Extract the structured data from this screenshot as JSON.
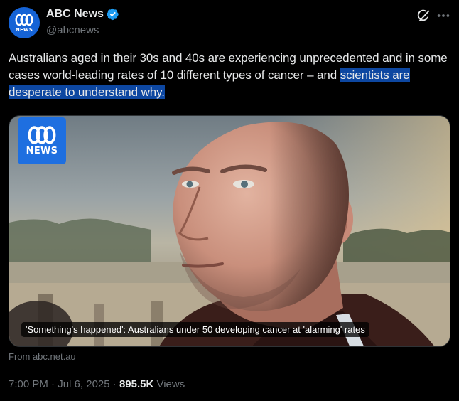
{
  "account": {
    "display_name": "ABC News",
    "handle": "@abcnews",
    "avatar_text": "NEWS"
  },
  "tweet": {
    "text_plain": "Australians aged in their 30s and 40s are experiencing unprecedented and in some cases world-leading rates of 10 different types of cancer – and ",
    "text_highlighted": "scientists are desperate to understand why."
  },
  "card": {
    "logo_text": "NEWS",
    "caption": "'Something's happened': Australians under 50 developing cancer at 'alarming' rates",
    "source": "From abc.net.au"
  },
  "meta": {
    "time": "7:00 PM",
    "separator1": " · ",
    "date": "Jul 6, 2025",
    "separator2": " · ",
    "views_count": "895.5K",
    "views_label": " Views"
  },
  "colors": {
    "background": "#000000",
    "text": "#e7e9ea",
    "secondary_text": "#71767b",
    "verified": "#1d9bf0",
    "highlight": "#0d47a1",
    "abc_blue": "#1e6fe0"
  },
  "icons": [
    "abc-news-logo-icon",
    "verified-badge-icon",
    "grok-icon",
    "more-options-icon"
  ]
}
